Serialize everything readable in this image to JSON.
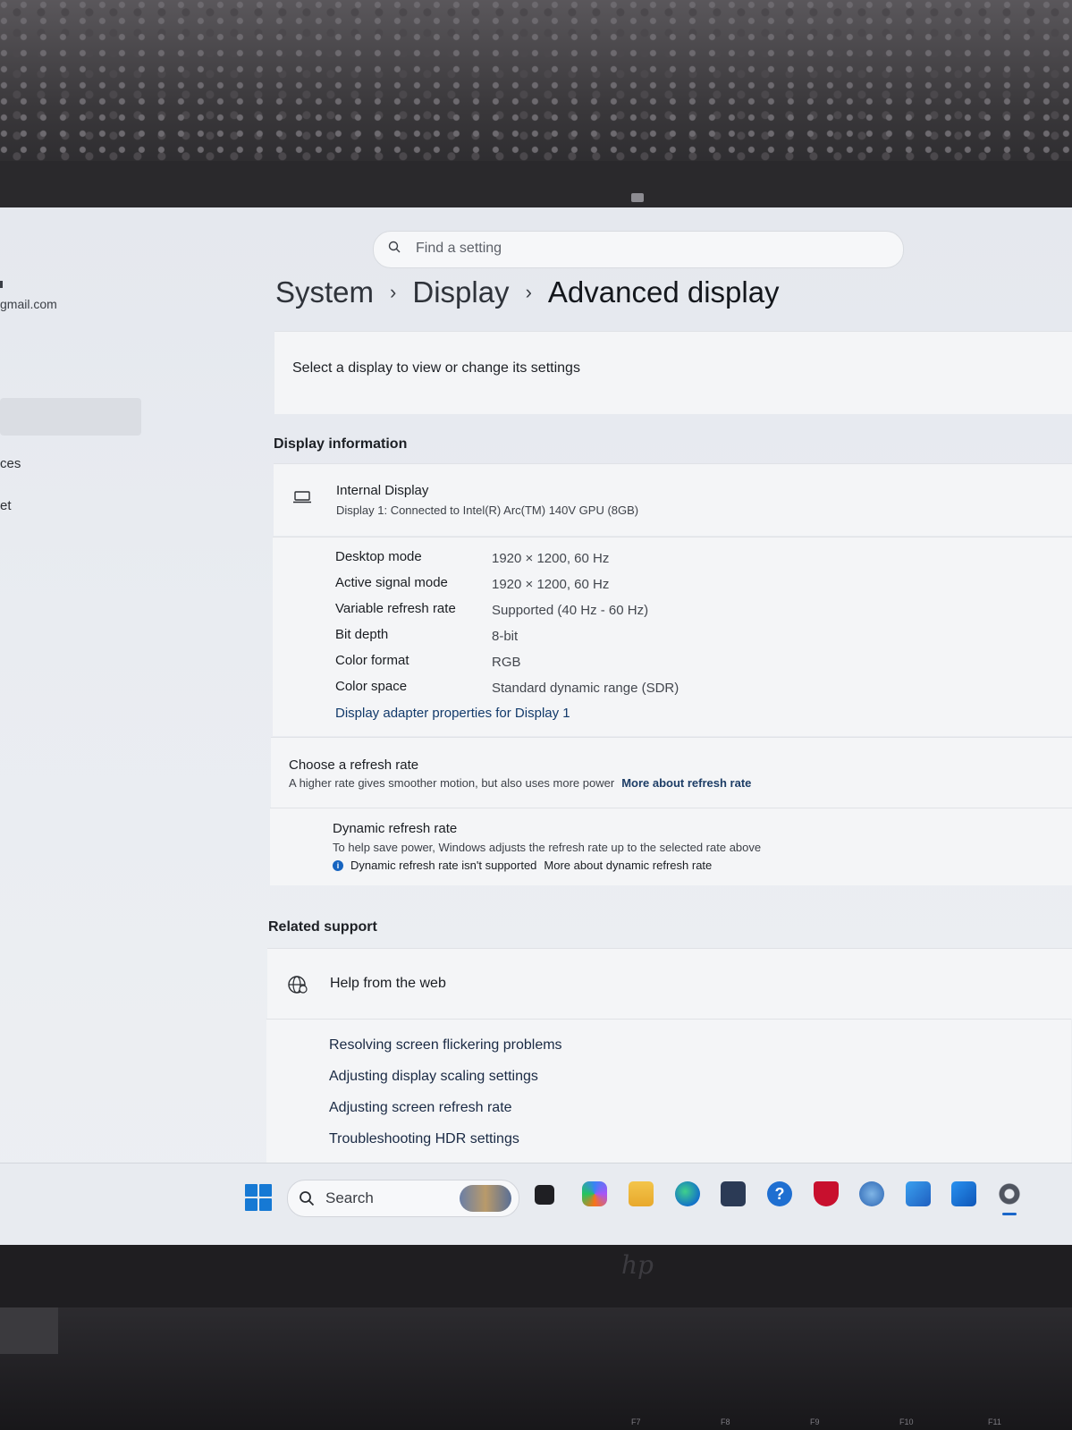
{
  "left_nav": {
    "email_fragment": "gmail.com",
    "item_fragment_1": "ces",
    "item_fragment_2": "et"
  },
  "search": {
    "placeholder": "Find a setting"
  },
  "breadcrumb": {
    "items": [
      "System",
      "Display",
      "Advanced display"
    ]
  },
  "select_display": {
    "label": "Select a display to view or change its settings"
  },
  "display_information": {
    "section_title": "Display information",
    "display_name": "Internal Display",
    "display_subtitle": "Display 1: Connected to Intel(R) Arc(TM) 140V GPU (8GB)",
    "rows": [
      {
        "label": "Desktop mode",
        "value": "1920 × 1200, 60 Hz"
      },
      {
        "label": "Active signal mode",
        "value": "1920 × 1200, 60 Hz"
      },
      {
        "label": "Variable refresh rate",
        "value": "Supported (40 Hz - 60 Hz)"
      },
      {
        "label": "Bit depth",
        "value": "8-bit"
      },
      {
        "label": "Color format",
        "value": "RGB"
      },
      {
        "label": "Color space",
        "value": "Standard dynamic range (SDR)"
      }
    ],
    "adapter_link": "Display adapter properties for Display 1"
  },
  "refresh_rate": {
    "title": "Choose a refresh rate",
    "description": "A higher rate gives smoother motion, but also uses more power",
    "more_link": "More about refresh rate"
  },
  "dynamic_refresh": {
    "title": "Dynamic refresh rate",
    "description": "To help save power, Windows adjusts the refresh rate up to the selected rate above",
    "not_supported": "Dynamic refresh rate isn't supported",
    "more_link": "More about dynamic refresh rate"
  },
  "related_support": {
    "section_title": "Related support",
    "help_title": "Help from the web",
    "links": [
      "Resolving screen flickering problems",
      "Adjusting display scaling settings",
      "Adjusting screen refresh rate",
      "Troubleshooting HDR settings"
    ]
  },
  "taskbar": {
    "search_label": "Search",
    "apps": [
      "task-view",
      "copilot",
      "file-explorer",
      "edge",
      "microsoft-store",
      "help",
      "mcafee",
      "app-beta",
      "app-pre",
      "outlook",
      "settings"
    ]
  },
  "keyboard": {
    "fkeys": [
      "F7",
      "F8",
      "F9",
      "F10",
      "F11"
    ]
  },
  "colors": {
    "accent": "#1a66c9",
    "link": "#123a6b"
  }
}
